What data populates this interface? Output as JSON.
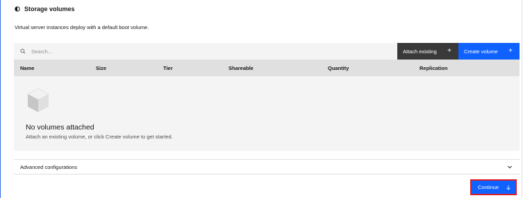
{
  "section": {
    "title": "Storage volumes",
    "icon": "half-circle-icon"
  },
  "description": "Virtual server instances deploy with a default boot volume.",
  "toolbar": {
    "search_placeholder": "Search...",
    "attach_label": "Attach existing",
    "create_label": "Create volume",
    "plus_symbol": "+"
  },
  "table": {
    "headers": [
      "Name",
      "Size",
      "Tier",
      "Shareable",
      "Quantity",
      "Replication"
    ]
  },
  "empty_state": {
    "title": "No volumes attached",
    "subtitle": "Attach an existing volume, or click Create volume to get started."
  },
  "accordion": {
    "title": "Advanced configurations"
  },
  "footer": {
    "continue_label": "Continue"
  },
  "colors": {
    "primary": "#0f62fe",
    "dark_button": "#393939",
    "highlight_border": "#da1e28"
  }
}
